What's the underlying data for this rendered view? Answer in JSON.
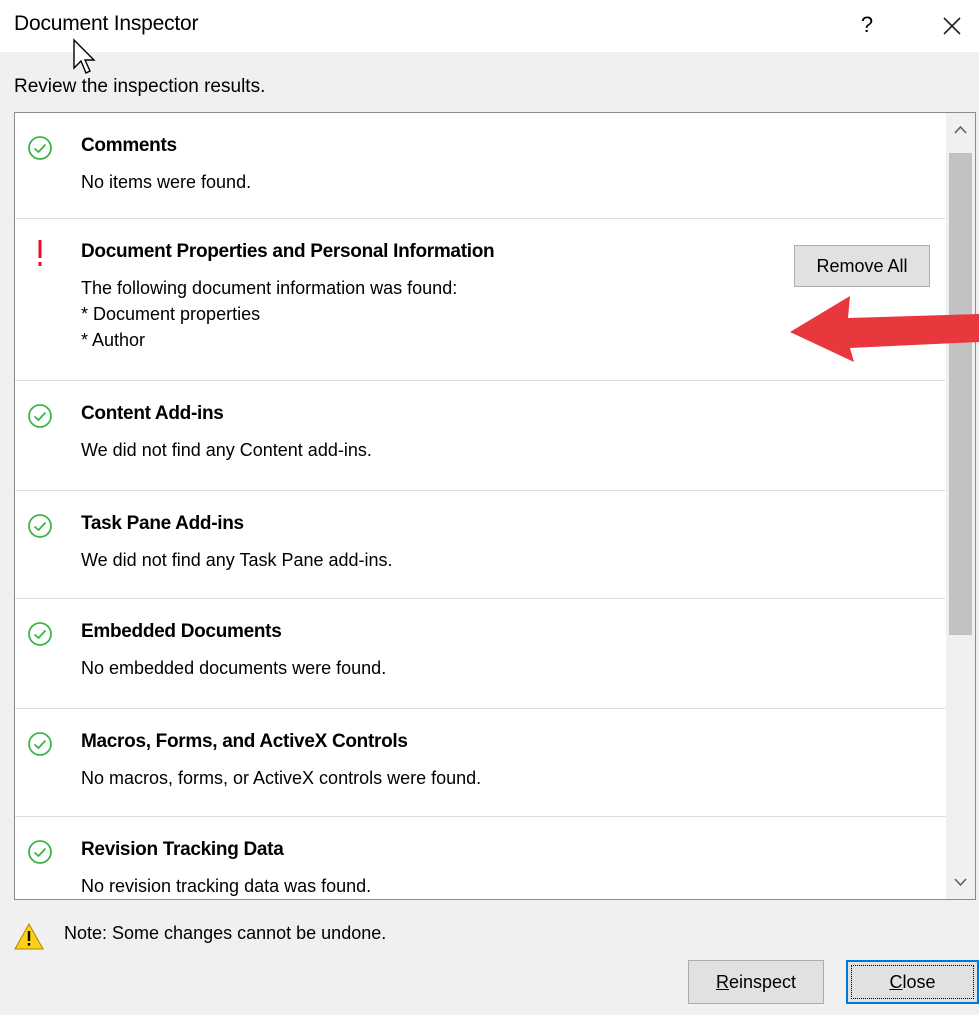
{
  "window": {
    "title": "Document Inspector",
    "help_label": "?"
  },
  "subtitle": "Review the inspection results.",
  "results": [
    {
      "status": "ok",
      "title": "Comments",
      "description": "No items were found."
    },
    {
      "status": "warning",
      "title": "Document Properties and Personal Information",
      "description": "The following document information was found:\n* Document properties\n* Author"
    },
    {
      "status": "ok",
      "title": "Content Add-ins",
      "description": "We did not find any Content add-ins."
    },
    {
      "status": "ok",
      "title": "Task Pane Add-ins",
      "description": "We did not find any Task Pane add-ins."
    },
    {
      "status": "ok",
      "title": "Embedded Documents",
      "description": "No embedded documents were found."
    },
    {
      "status": "ok",
      "title": "Macros, Forms, and ActiveX Controls",
      "description": "No macros, forms, or ActiveX controls were found."
    },
    {
      "status": "ok",
      "title": "Revision Tracking Data",
      "description": "No revision tracking data was found."
    }
  ],
  "remove_all_label": "Remove All",
  "note": "Note: Some changes cannot be undone.",
  "buttons": {
    "reinspect_first": "R",
    "reinspect_rest": "einspect",
    "close_first": "C",
    "close_rest": "lose"
  },
  "colors": {
    "ok": "#3bb44a",
    "warning": "#e81123",
    "accent": "#0078d7",
    "annotation_arrow": "#e8383d"
  }
}
